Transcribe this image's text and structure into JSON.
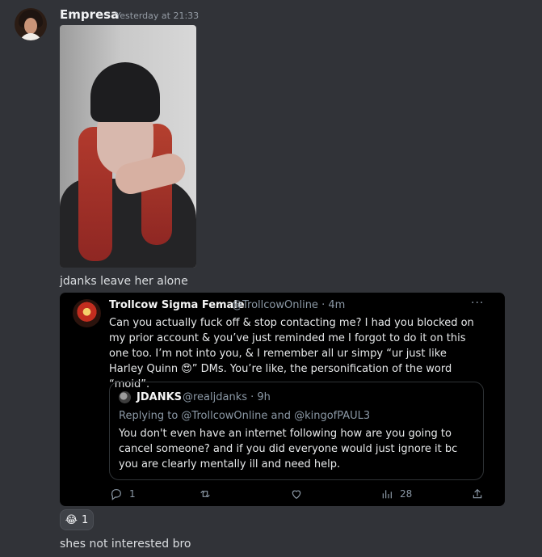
{
  "message": {
    "author": "Empresa",
    "timestamp": "Yesterday at 21:33",
    "caption": "jdanks leave her alone",
    "follow_up": "shes not interested bro"
  },
  "tweet": {
    "display_name": "Trollcow Sigma Female",
    "handle_time": "@TrollcowOnline · 4m",
    "more": "···",
    "body": "Can you actually fuck off & stop contacting me? I had you blocked on my prior account & you’ve just reminded me I forgot to do it on this one too. I’m not into you, & I remember all ur simpy “ur just like Harley Quinn 😍” DMs. You’re like, the personification of the word “moid”.",
    "quote": {
      "display_name": "JDANKS",
      "handle_time": "@realjdanks · 9h",
      "reply_context": "Replying to @TrollcowOnline and @kingofPAUL3",
      "body": "You don't even have an internet following how are you going to cancel someone? and if you did everyone would just ignore it bc you are clearly mentally ill and need help."
    },
    "actions": {
      "reply_count": "1",
      "retweet_count": "",
      "like_count": "",
      "view_count": "28",
      "share_count": ""
    }
  },
  "reaction": {
    "emoji": "😂",
    "count": "1"
  }
}
